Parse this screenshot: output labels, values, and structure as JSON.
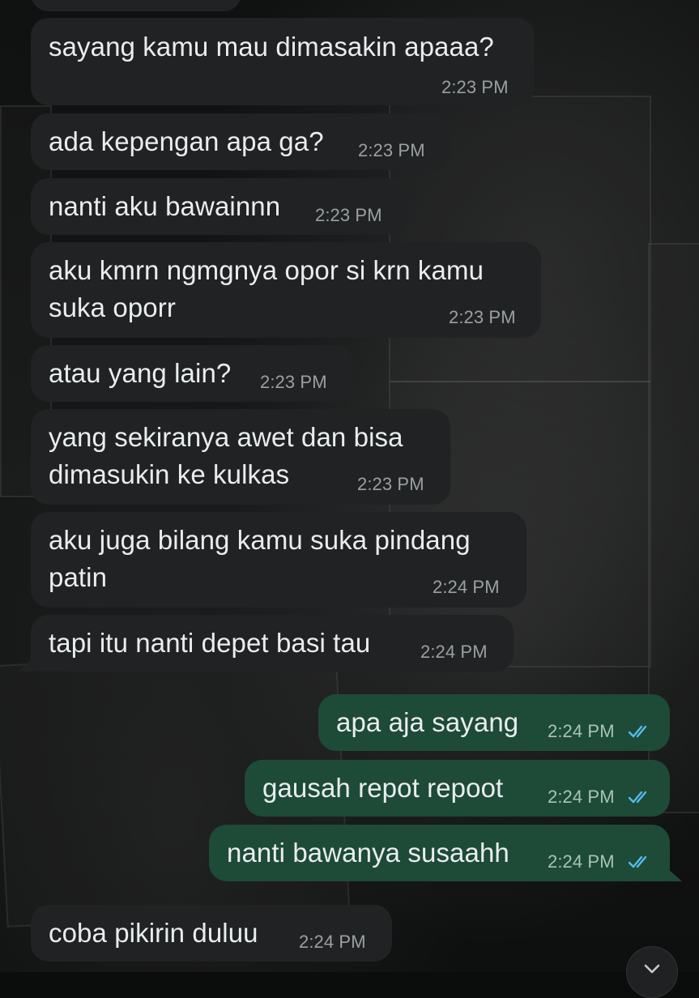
{
  "messages": [
    {
      "direction": "incoming",
      "text": "sayang kamu mau dimasakin apaaa?",
      "time": "2:23 PM"
    },
    {
      "direction": "incoming",
      "text": "ada kepengan apa ga?",
      "time": "2:23 PM"
    },
    {
      "direction": "incoming",
      "text": "nanti aku bawainnn",
      "time": "2:23 PM"
    },
    {
      "direction": "incoming",
      "text": "aku kmrn ngmgnya opor si krn kamu\nsuka oporr",
      "time": "2:23 PM"
    },
    {
      "direction": "incoming",
      "text": "atau yang lain?",
      "time": "2:23 PM"
    },
    {
      "direction": "incoming",
      "text": "yang sekiranya awet dan bisa\ndimasukin ke kulkas",
      "time": "2:23 PM"
    },
    {
      "direction": "incoming",
      "text": "aku juga bilang kamu suka pindang\npatin",
      "time": "2:24 PM"
    },
    {
      "direction": "incoming",
      "text": "tapi itu nanti depet basi tau",
      "time": "2:24 PM"
    },
    {
      "direction": "outgoing",
      "text": "apa aja sayang",
      "time": "2:24 PM",
      "status": "read"
    },
    {
      "direction": "outgoing",
      "text": "gausah repot repoot",
      "time": "2:24 PM",
      "status": "read"
    },
    {
      "direction": "outgoing",
      "text": "nanti bawanya susaahh",
      "time": "2:24 PM",
      "status": "read"
    },
    {
      "direction": "incoming",
      "text": "coba pikirin duluu",
      "time": "2:24 PM"
    }
  ],
  "colors": {
    "incoming_bubble": "#202223",
    "outgoing_bubble": "#1e4a38",
    "read_ticks": "#53bdeb"
  },
  "icons": {
    "read_receipt": "double-check-icon",
    "scroll_down": "chevron-down-icon"
  }
}
